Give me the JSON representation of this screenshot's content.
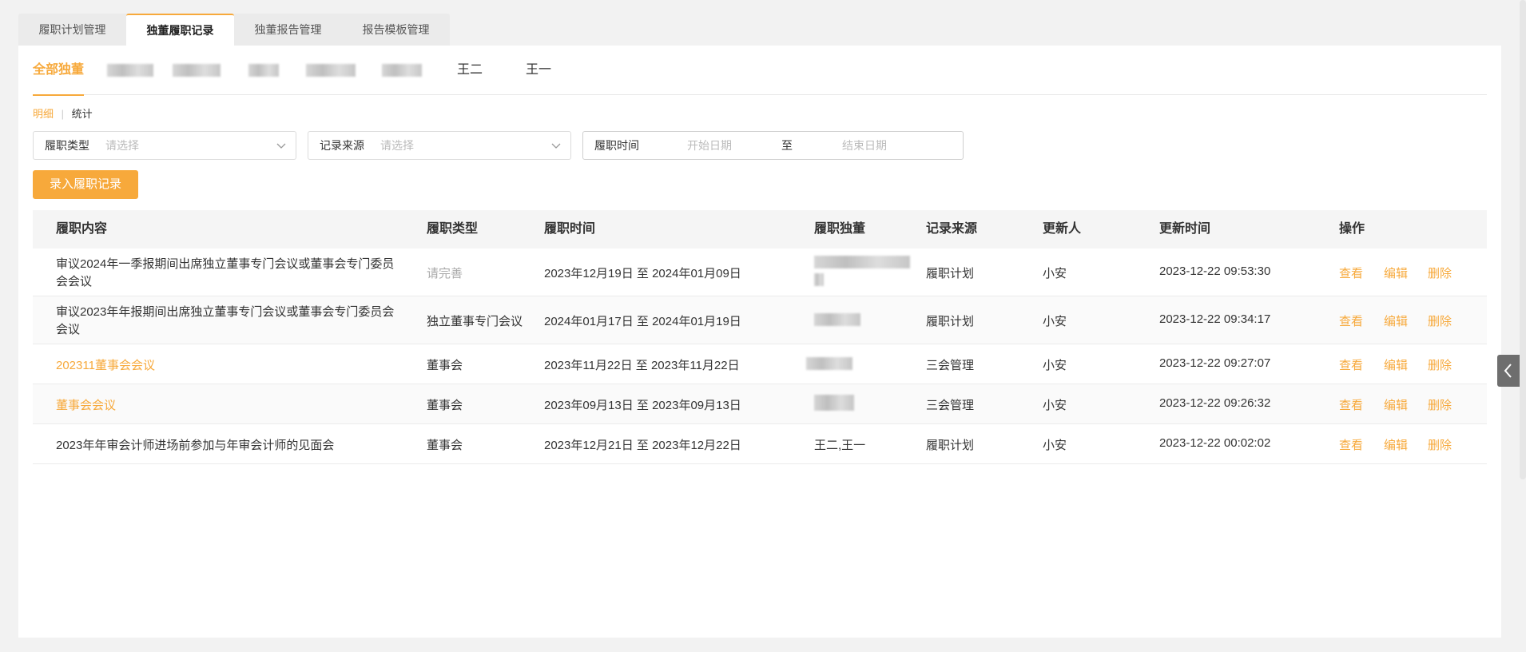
{
  "top_tabs": [
    "履职计划管理",
    "独董履职记录",
    "独董报告管理",
    "报告模板管理"
  ],
  "director_tabs": {
    "all": "全部独董",
    "named": [
      "王二",
      "王一"
    ]
  },
  "view_switch": {
    "detail": "明细",
    "separator": "|",
    "stats": "统计"
  },
  "filters": {
    "type": {
      "label": "履职类型",
      "placeholder": "请选择"
    },
    "source": {
      "label": "记录来源",
      "placeholder": "请选择"
    },
    "time": {
      "label": "履职时间",
      "start_placeholder": "开始日期",
      "to": "至",
      "end_placeholder": "结束日期"
    }
  },
  "add_button": "录入履职记录",
  "table": {
    "headers": [
      "履职内容",
      "履职类型",
      "履职时间",
      "履职独董",
      "记录来源",
      "更新人",
      "更新时间",
      "操作"
    ],
    "rows": [
      {
        "content_line1": "审议2024年一季报期间出席独立董事专门会议或董事会专门委员",
        "content_line2": "会会议",
        "type": "请完善",
        "time": "2023年12月19日 至 2024年01月09日",
        "director": "",
        "source": "履职计划",
        "updater": "小安",
        "updated": "2023-12-22 09:53:30"
      },
      {
        "content_line1": "审议2023年年报期间出席独立董事专门会议或董事会专门委员会",
        "content_line2": "会议",
        "type": "独立董事专门会议",
        "time": "2024年01月17日 至 2024年01月19日",
        "director": "",
        "source": "履职计划",
        "updater": "小安",
        "updated": "2023-12-22 09:34:17"
      },
      {
        "content_line1": "202311董事会会议",
        "content_line2": "",
        "type": "董事会",
        "time": "2023年11月22日 至 2023年11月22日",
        "director": "",
        "source": "三会管理",
        "updater": "小安",
        "updated": "2023-12-22 09:27:07"
      },
      {
        "content_line1": "董事会会议",
        "content_line2": "",
        "type": "董事会",
        "time": "2023年09月13日 至 2023年09月13日",
        "director": "",
        "source": "三会管理",
        "updater": "小安",
        "updated": "2023-12-22 09:26:32"
      },
      {
        "content_line1": "2023年年审会计师进场前参加与年审会计师的见面会",
        "content_line2": "",
        "type": "董事会",
        "time": "2023年12月21日 至 2023年12月22日",
        "director": "王二,王一",
        "source": "履职计划",
        "updater": "小安",
        "updated": "2023-12-22 00:02:02"
      }
    ],
    "actions": {
      "view": "查看",
      "edit": "编辑",
      "delete": "删除"
    }
  },
  "colors": {
    "accent": "#f7a93b",
    "header_bg": "#f5f5f5",
    "page_bg": "#f2f2f2"
  }
}
